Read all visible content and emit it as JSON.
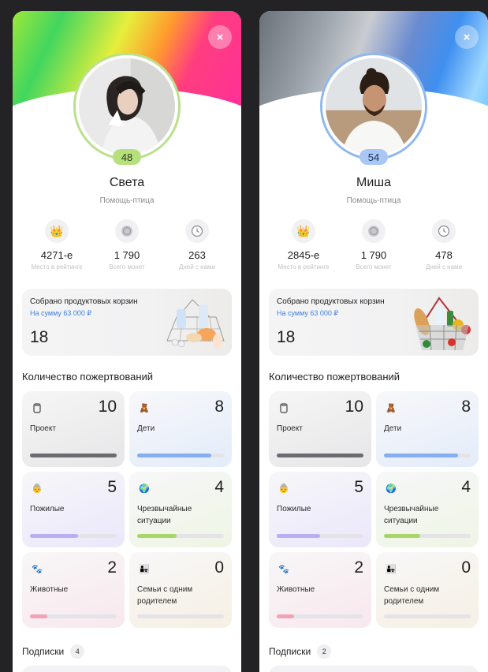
{
  "profiles": [
    {
      "close_label": "×",
      "level": "48",
      "name": "Света",
      "subtitle": "Помощь-птица",
      "stats": [
        {
          "icon": "crown-icon",
          "value": "4271-е",
          "label": "Место в рейтинге"
        },
        {
          "icon": "coin-icon",
          "value": "1 790",
          "label": "Всего монет"
        },
        {
          "icon": "clock-icon",
          "value": "263",
          "label": "Дней с нами"
        }
      ],
      "basket": {
        "title": "Собрано продуктовых корзин",
        "sum": "На сумму 63 000 ₽",
        "count": "18"
      },
      "donations_title": "Количество пожертвований",
      "tiles": [
        {
          "icon": "project-icon",
          "count": "10",
          "label": "Проект",
          "progress": 1.0,
          "color": "#6b6b70"
        },
        {
          "icon": "children-icon",
          "count": "8",
          "label": "Дети",
          "progress": 0.85,
          "color": "#86aef0"
        },
        {
          "icon": "elderly-icon",
          "count": "5",
          "label": "Пожилые",
          "progress": 0.55,
          "color": "#b8b0f0"
        },
        {
          "icon": "globe-icon",
          "count": "4",
          "label": "Чрезвычайные ситуации",
          "progress": 0.45,
          "color": "#a8d66a"
        },
        {
          "icon": "paw-icon",
          "count": "2",
          "label": "Животные",
          "progress": 0.2,
          "color": "#f3a1b5"
        },
        {
          "icon": "family-icon",
          "count": "0",
          "label": "Семьи с одним родителем",
          "progress": 0.0,
          "color": "#e9c46a"
        }
      ],
      "subscriptions": {
        "label": "Подписки",
        "count": "4"
      }
    },
    {
      "close_label": "×",
      "level": "54",
      "name": "Миша",
      "subtitle": "Помощь-птица",
      "stats": [
        {
          "icon": "crown-icon",
          "value": "2845-е",
          "label": "Место в рейтинге"
        },
        {
          "icon": "coin-icon",
          "value": "1 790",
          "label": "Всего монет"
        },
        {
          "icon": "clock-icon",
          "value": "478",
          "label": "Дней с нами"
        }
      ],
      "basket": {
        "title": "Собрано продуктовых корзин",
        "sum": "На сумму 63 000 ₽",
        "count": "18"
      },
      "donations_title": "Количество пожертвований",
      "tiles": [
        {
          "icon": "project-icon",
          "count": "10",
          "label": "Проект",
          "progress": 1.0,
          "color": "#6b6b70"
        },
        {
          "icon": "children-icon",
          "count": "8",
          "label": "Дети",
          "progress": 0.85,
          "color": "#86aef0"
        },
        {
          "icon": "elderly-icon",
          "count": "5",
          "label": "Пожилые",
          "progress": 0.5,
          "color": "#b8b0f0"
        },
        {
          "icon": "globe-icon",
          "count": "4",
          "label": "Чрезвычайные ситуации",
          "progress": 0.42,
          "color": "#a8d66a"
        },
        {
          "icon": "paw-icon",
          "count": "2",
          "label": "Животные",
          "progress": 0.2,
          "color": "#f3a1b5"
        },
        {
          "icon": "family-icon",
          "count": "0",
          "label": "Семьи с одним родителем",
          "progress": 0.0,
          "color": "#e9c46a"
        }
      ],
      "subscriptions": {
        "label": "Подписки",
        "count": "2"
      }
    }
  ]
}
